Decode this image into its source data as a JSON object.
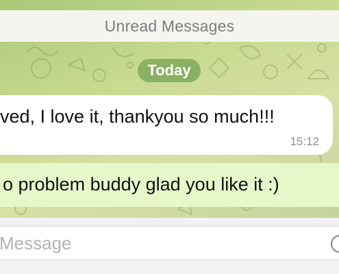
{
  "chat": {
    "unread_banner": "Unread Messages",
    "date_separator": "Today",
    "messages": [
      {
        "direction": "incoming",
        "text": "ved, I love it, thankyou so much!!!",
        "time": "15:12"
      },
      {
        "direction": "outgoing",
        "text": "o problem buddy glad you like it :)"
      }
    ]
  },
  "composer": {
    "placeholder": "Message",
    "value": ""
  },
  "icons": {
    "sticker": "sticker-icon",
    "background": "doodle-pattern"
  },
  "colors": {
    "background_start": "#a9c977",
    "background_end": "#b9cf96",
    "date_pill": "#8ab163",
    "incoming_bubble": "#ffffff",
    "outgoing_bubble": "#e6f8ca"
  }
}
